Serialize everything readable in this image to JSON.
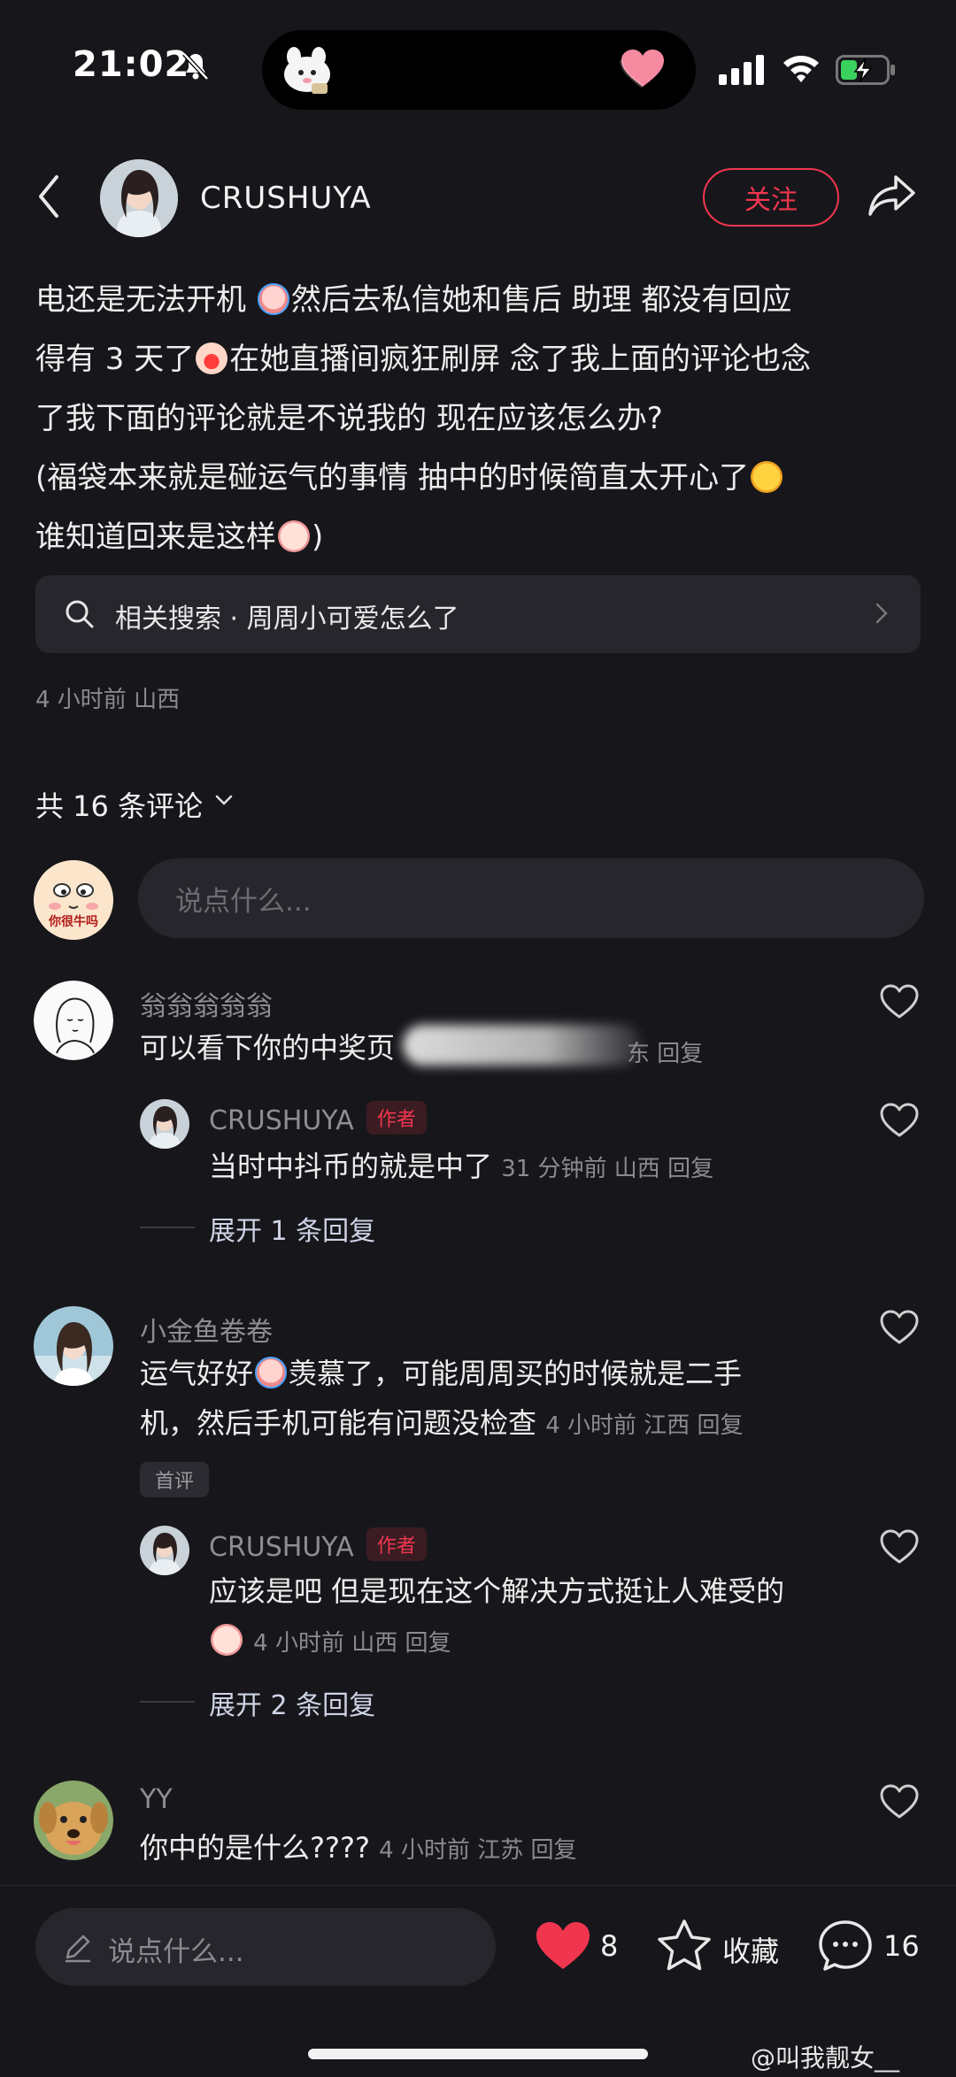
{
  "status_bar": {
    "time": "21:02"
  },
  "header": {
    "username": "CRUSHUYA",
    "follow_label": "关注"
  },
  "post": {
    "line1a": "电还是无法开机",
    "line1b": "然后去私信她和售后 助理 都没有回应",
    "line2a": "得有 3 天了",
    "line2b": "在她直播间疯狂刷屏 念了我上面的评论也念",
    "line3": "了我下面的评论就是不说我的 现在应该怎么办?",
    "line4a": "(福袋本来就是碰运气的事情 抽中的时候简直太开心了",
    "line5a": "谁知道回来是这样",
    "line5b": ")",
    "related_search": "相关搜索 · 周周小可爱怎么了",
    "meta": "4 小时前 山西"
  },
  "comments_header": {
    "count_label": "共 16 条评论"
  },
  "comment_input": {
    "placeholder": "说点什么..."
  },
  "comments": [
    {
      "name": "翁翁翁翁翁",
      "text_prefix": "可以看下你的中奖页",
      "meta_tail": "东 回复"
    },
    {
      "name": "CRUSHUYA",
      "tag": "作者",
      "text": "当时中抖币的就是中了",
      "meta": "31 分钟前 山西 回复",
      "expand": "展开 1 条回复"
    },
    {
      "name": "小金鱼卷卷",
      "text_a": "运气好好",
      "text_b": "羡慕了，可能周周买的时候就是二手",
      "text_c": "机，然后手机可能有问题没检查",
      "meta": "4 小时前 江西 回复",
      "badge": "首评"
    },
    {
      "name": "CRUSHUYA",
      "tag": "作者",
      "text": "应该是吧 但是现在这个解决方式挺让人难受的",
      "meta": "4 小时前 山西 回复",
      "expand": "展开 2 条回复"
    },
    {
      "name": "YY",
      "text": "你中的是什么????",
      "meta": "4 小时前 江苏 回复"
    }
  ],
  "bottom_bar": {
    "input_placeholder": "说点什么...",
    "like_count": "8",
    "favorite_label": "收藏",
    "comment_count": "16",
    "accent_color": "#f0364f"
  },
  "watermark": "@叫我靓女__",
  "my_avatar_text": "你很牛吗"
}
